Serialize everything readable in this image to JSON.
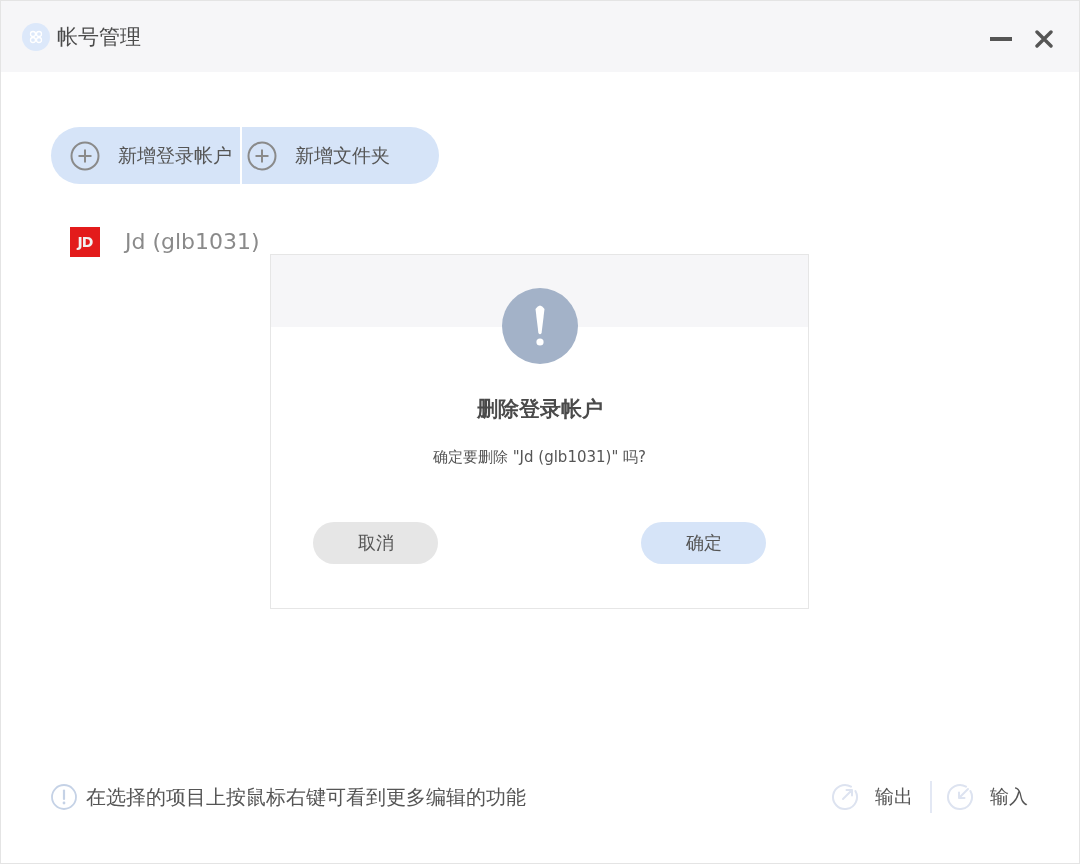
{
  "window": {
    "title": "帐号管理"
  },
  "toolbar": {
    "buttons": [
      {
        "label": "新增登录帐户"
      },
      {
        "label": "新增文件夹"
      }
    ]
  },
  "accounts": [
    {
      "icon_text": "JD",
      "label": "Jd (glb1031)"
    }
  ],
  "dialog": {
    "title": "删除登录帐户",
    "message": "确定要删除 \"Jd (glb1031)\" 吗?",
    "buttons": [
      {
        "label": "取消",
        "kind": "secondary"
      },
      {
        "label": "确定",
        "kind": "primary"
      }
    ]
  },
  "footer": {
    "hint": "在选择的项目上按鼠标右键可看到更多编辑的功能",
    "actions": [
      {
        "label": "输出",
        "kind": "export"
      },
      {
        "label": "输入",
        "kind": "import"
      }
    ]
  }
}
